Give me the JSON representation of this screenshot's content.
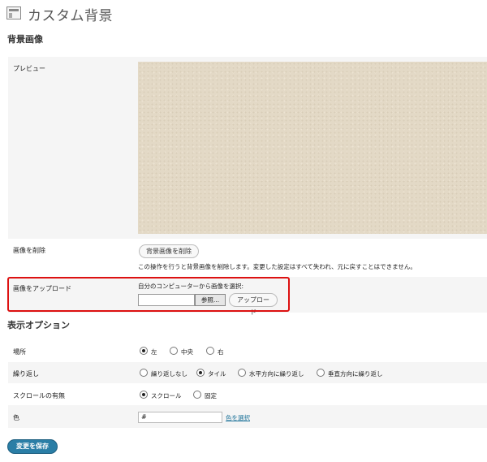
{
  "header": {
    "title": "カスタム背景"
  },
  "background_image": {
    "section_title": "背景画像",
    "preview_label": "プレビュー",
    "remove_label": "画像を削除",
    "remove_button": "背景画像を削除",
    "remove_description": "この操作を行うと背景画像を削除します。変更した設定はすべて失われ、元に戻すことはできません。",
    "upload_label": "画像をアップロード",
    "upload_instruction": "自分のコンピューターから画像を選択:",
    "browse_button": "参照...",
    "upload_button": "アップロード"
  },
  "display_options": {
    "section_title": "表示オプション",
    "position": {
      "label": "場所",
      "options": [
        "左",
        "中央",
        "右"
      ],
      "selected": "左"
    },
    "repeat": {
      "label": "繰り返し",
      "options": [
        "繰り返しなし",
        "タイル",
        "水平方向に繰り返し",
        "垂直方向に繰り返し"
      ],
      "selected": "タイル"
    },
    "attachment": {
      "label": "スクロールの有無",
      "options": [
        "スクロール",
        "固定"
      ],
      "selected": "スクロール"
    },
    "color": {
      "label": "色",
      "value": "#",
      "select_link": "色を選択"
    }
  },
  "footer": {
    "save_button": "変更を保存"
  },
  "colors": {
    "preview_bg": "#e3d9c6",
    "highlight_border": "#dd1111",
    "primary_button": "#2a7ea6",
    "link": "#21759b"
  }
}
